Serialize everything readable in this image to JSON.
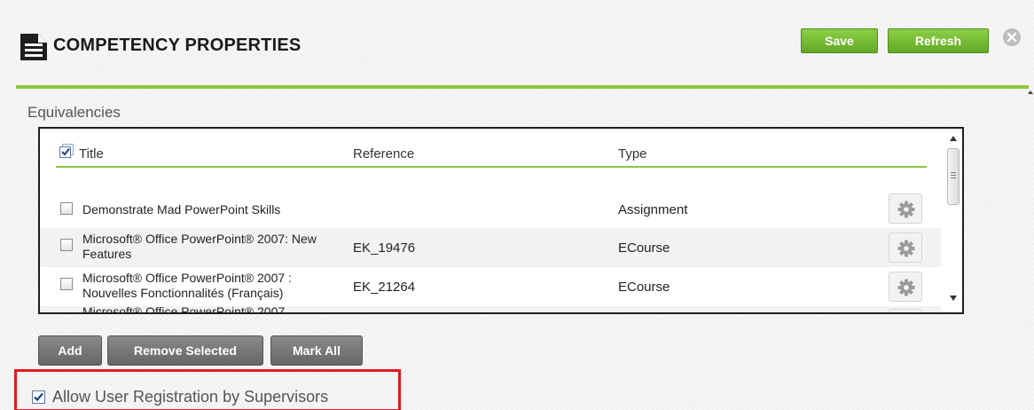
{
  "header": {
    "title": "COMPETENCY PROPERTIES",
    "title_icon": "document-lines-icon",
    "save_label": "Save",
    "refresh_label": "Refresh",
    "close_icon": "close-circle-icon"
  },
  "equivalencies": {
    "section_label": "Equivalencies",
    "columns": {
      "title": "Title",
      "reference": "Reference",
      "type": "Type"
    },
    "rows": [
      {
        "title": "Demonstrate Mad PowerPoint Skills",
        "reference": "",
        "type": "Assignment",
        "checked": false
      },
      {
        "title": "Microsoft® Office PowerPoint® 2007: New Features",
        "reference": "EK_19476",
        "type": "ECourse",
        "checked": false
      },
      {
        "title": "Microsoft® Office PowerPoint® 2007 : Nouvelles Fonctionnalités (Français)",
        "reference": "EK_21264",
        "type": "ECourse",
        "checked": false
      },
      {
        "title": "Microsoft® Office PowerPoint® 2007",
        "reference": "",
        "type": "",
        "checked": false
      }
    ]
  },
  "actions": {
    "add_label": "Add",
    "remove_label": "Remove Selected",
    "mark_all_label": "Mark All"
  },
  "options": {
    "allow_registration_label": "Allow User Registration by Supervisors",
    "allow_registration_checked": true
  },
  "colors": {
    "accent_green": "#8dc63f",
    "highlight_red": "#e11b22"
  }
}
